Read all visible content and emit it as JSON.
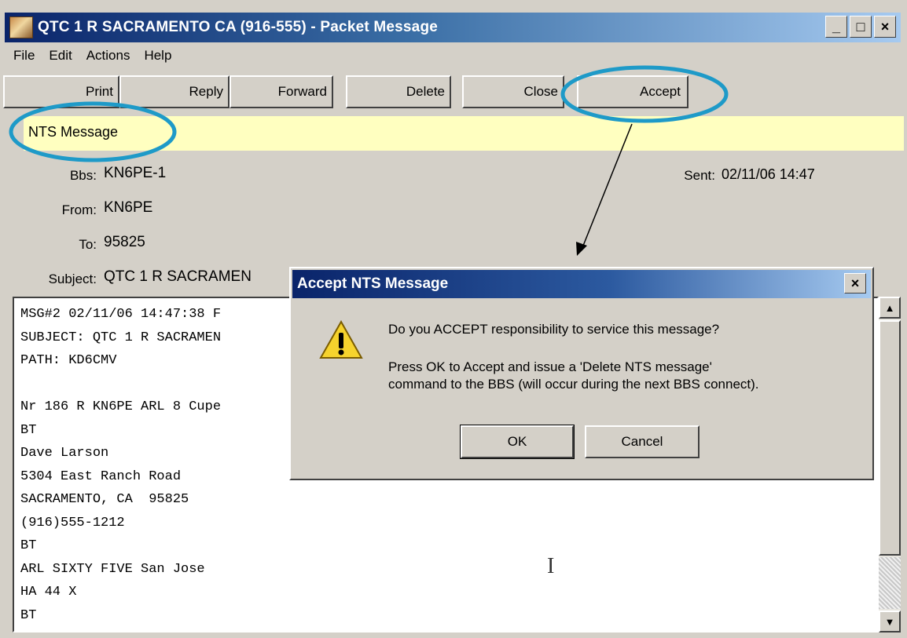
{
  "window": {
    "title": "QTC 1 R SACRAMENTO CA (916-555) - Packet Message",
    "minimize": "_",
    "maximize": "□",
    "close": "×"
  },
  "menu": [
    "File",
    "Edit",
    "Actions",
    "Help"
  ],
  "toolbar": [
    "Print",
    "Reply",
    "Forward",
    "Delete",
    "Close",
    "Accept"
  ],
  "banner": {
    "label": "NTS Message"
  },
  "header": {
    "bbs_label": "Bbs:",
    "bbs_value": "KN6PE-1",
    "from_label": "From:",
    "from_value": "KN6PE",
    "to_label": "To:",
    "to_value": "95825",
    "subject_label": "Subject:",
    "subject_value": "QTC 1 R SACRAMEN",
    "sent_label": "Sent:",
    "sent_value": "02/11/06 14:47"
  },
  "message_lines": [
    "MSG#2 02/11/06 14:47:38 F",
    "SUBJECT: QTC 1 R SACRAMEN",
    "PATH: KD6CMV",
    "",
    "Nr 186 R KN6PE ARL 8 Cupe",
    "BT",
    "Dave Larson",
    "5304 East Ranch Road",
    "SACRAMENTO, CA  95825",
    "(916)555-1212",
    "BT",
    "ARL SIXTY FIVE San Jose",
    "HA 44 X",
    "BT"
  ],
  "dialog": {
    "title": "Accept NTS Message",
    "close": "×",
    "question": "Do you ACCEPT responsibility to service this message?",
    "info_line1": "Press OK to Accept and issue a 'Delete NTS message'",
    "info_line2": "command to the BBS  (will occur during the next BBS connect).",
    "ok": "OK",
    "cancel": "Cancel",
    "icon": "warning-icon"
  },
  "cursor": "I",
  "colors": {
    "annotation": "#1e9ac8",
    "banner": "#ffffc0",
    "titlebar": "#0a246a"
  }
}
